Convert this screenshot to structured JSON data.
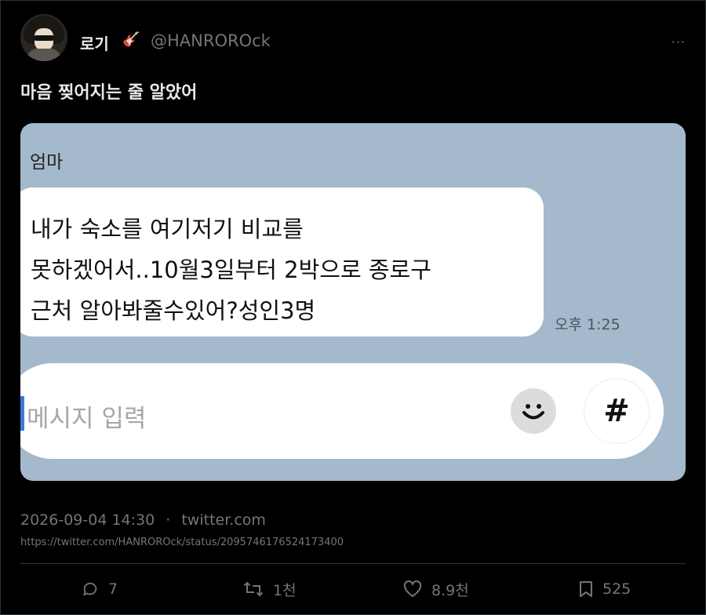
{
  "author": {
    "name": "로기",
    "emoji": "🎸",
    "handle": "@HANROROck"
  },
  "tweet": {
    "text": "마음 찢어지는 줄 알았어"
  },
  "media": {
    "sender": "엄마",
    "message_lines": [
      "내가 숙소를 여기저기 비교를",
      "못하겠어서..10월3일부터 2박으로 종로구",
      "근처 알아봐줄수있어?성인3명"
    ],
    "time": "오후 1:25",
    "input_placeholder": "메시지 입력",
    "emoji_icon": "smiley-icon",
    "hash_icon": "#"
  },
  "meta": {
    "datetime": "2026-09-04 14:30",
    "separator": "·",
    "source": "twitter.com",
    "url": "https://twitter.com/HANROROck/status/2095746176524173400"
  },
  "actions": {
    "replies": "7",
    "retweets": "1천",
    "likes": "8.9천",
    "bookmarks": "525"
  },
  "more_label": "···",
  "colors": {
    "background": "#000000",
    "chat_bg": "#a4b9cb",
    "muted": "#71767b"
  }
}
